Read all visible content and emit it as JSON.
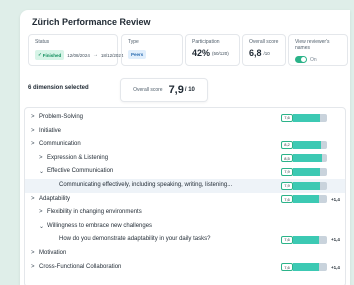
{
  "title": "Zürich Performance Review",
  "status": {
    "label": "Status",
    "value": "Finished",
    "start": "12/08/2024",
    "end": "18/12/2024"
  },
  "type": {
    "label": "Type",
    "value": "Peers"
  },
  "participation": {
    "label": "Participation",
    "value": "42%",
    "detail": "(50/120)"
  },
  "overall_score_card": {
    "label": "Overall score",
    "value": "6,8",
    "of": "/10"
  },
  "reviewer_names": {
    "label": "View reviewer's names",
    "state": "On"
  },
  "selected_count": "6 dimension selected",
  "overall_box": {
    "label": "Overall score",
    "value": "7,9",
    "of": "/ 10"
  },
  "rows": [
    {
      "label": "Problem-Solving",
      "chev": ">",
      "indent": 0,
      "score": "7,6",
      "fill": 0.78
    },
    {
      "label": "Initiative",
      "chev": ">",
      "indent": 0
    },
    {
      "label": "Communication",
      "chev": ">",
      "indent": 0,
      "score": "8,2",
      "fill": 0.82
    },
    {
      "label": "Expression & Listening",
      "chev": ">",
      "indent": 1,
      "score": "8,5",
      "fill": 0.85
    },
    {
      "label": "Effective Communication",
      "chev": "⌄",
      "indent": 1,
      "score": "7,9",
      "fill": 0.79
    },
    {
      "label": "Communicating effectively, including speaking, writing, listening...",
      "chev": "",
      "indent": 3,
      "score": "7,9",
      "fill": 0.79,
      "highlight": true
    },
    {
      "label": "Adaptability",
      "chev": ">",
      "indent": 0,
      "score": "7,6",
      "fill": 0.76,
      "delta": "+1,4"
    },
    {
      "label": "Flexibility in changing environments",
      "chev": ">",
      "indent": 1
    },
    {
      "label": "Willingness to embrace new challenges",
      "chev": "⌄",
      "indent": 1
    },
    {
      "label": "How do you demonstrate adaptability in your daily tasks?",
      "chev": "",
      "indent": 3,
      "score": "7,6",
      "fill": 0.76,
      "delta": "+1,4"
    },
    {
      "label": "Motivation",
      "chev": ">",
      "indent": 0
    },
    {
      "label": "Cross-Functional Collaboration",
      "chev": ">",
      "indent": 0,
      "score": "7,6",
      "fill": 0.76,
      "delta": "+1,4"
    }
  ]
}
